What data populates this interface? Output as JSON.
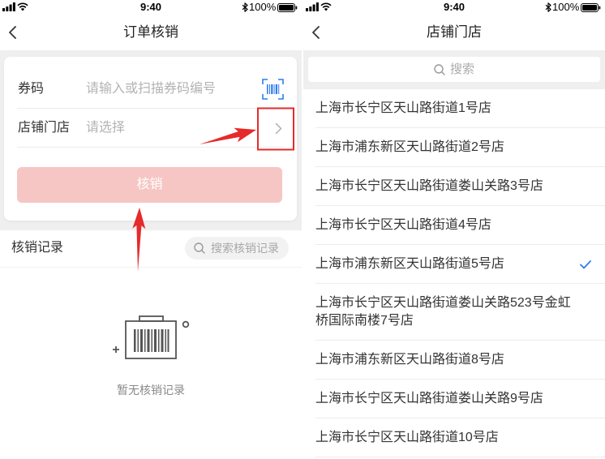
{
  "left": {
    "status_bar": {
      "time": "9:40",
      "battery": "100%"
    },
    "nav": {
      "title": "订单核销"
    },
    "form": {
      "coupon_label": "券码",
      "coupon_placeholder": "请输入或扫描券码编号",
      "store_label": "店铺门店",
      "store_placeholder": "请选择",
      "submit_label": "核销"
    },
    "records": {
      "title": "核销记录",
      "search_placeholder": "搜索核销记录",
      "empty_text": "暂无核销记录"
    }
  },
  "right": {
    "status_bar": {
      "time": "9:40",
      "battery": "100%"
    },
    "nav": {
      "title": "店铺门店"
    },
    "search": {
      "placeholder": "搜索"
    },
    "stores": [
      {
        "name": "上海市长宁区天山路街道1号店",
        "selected": false
      },
      {
        "name": "上海市浦东新区天山路街道2号店",
        "selected": false
      },
      {
        "name": "上海市长宁区天山路街道娄山关路3号店",
        "selected": false
      },
      {
        "name": "上海市长宁区天山路街道4号店",
        "selected": false
      },
      {
        "name": "上海市浦东新区天山路街道5号店",
        "selected": true
      },
      {
        "name": "上海市长宁区天山路街道娄山关路523号金虹桥国际南楼7号店",
        "selected": false
      },
      {
        "name": "上海市浦东新区天山路街道8号店",
        "selected": false
      },
      {
        "name": "上海市长宁区天山路街道娄山关路9号店",
        "selected": false
      },
      {
        "name": "上海市长宁区天山路街道10号店",
        "selected": false
      }
    ]
  },
  "icons": {
    "status": [
      "cellular-signal-icon",
      "wifi-icon",
      "bluetooth-icon",
      "battery-icon"
    ],
    "back": "back-chevron-icon",
    "scan": "scan-barcode-icon",
    "picker": "chevron-right-icon",
    "search": "search-icon",
    "selected": "checkmark-icon",
    "empty_state": "barcode-box-icon"
  },
  "colors": {
    "accent": "#2d7cf0",
    "submit_button": "#f6c6c4",
    "annotation": "#e62a2a",
    "background": "#efefef",
    "text": "#333333",
    "placeholder": "#b3b3b3"
  }
}
